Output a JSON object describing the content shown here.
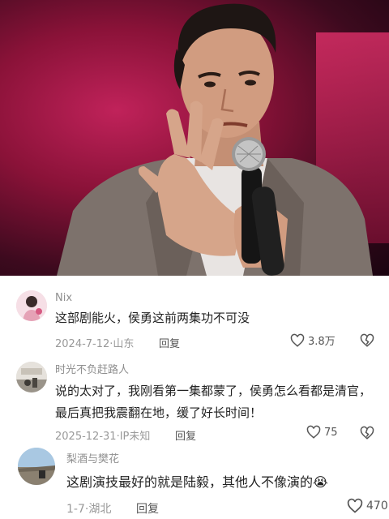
{
  "comments": [
    {
      "username": "Nix",
      "text": "这部剧能火，侯勇这前两集功不可没",
      "date": "2024-7-12",
      "location": "山东",
      "reply_label": "回复",
      "likes": "3.8万"
    },
    {
      "username": "时光不负赶路人",
      "text": "说的太对了，我刚看第一集都蒙了，侯勇怎么看都是清官，最后真把我震翻在地，缓了好长时间！",
      "date": "2025-12-31",
      "location": "IP未知",
      "reply_label": "回复",
      "likes": "75"
    },
    {
      "username": "梨酒与樊花",
      "text": "这剧演技最好的就是陆毅，其他人不像演的",
      "emoji": "😭",
      "date": "1-7",
      "location": "湖北",
      "reply_label": "回复",
      "likes": "470"
    }
  ],
  "meta_separator": "·"
}
